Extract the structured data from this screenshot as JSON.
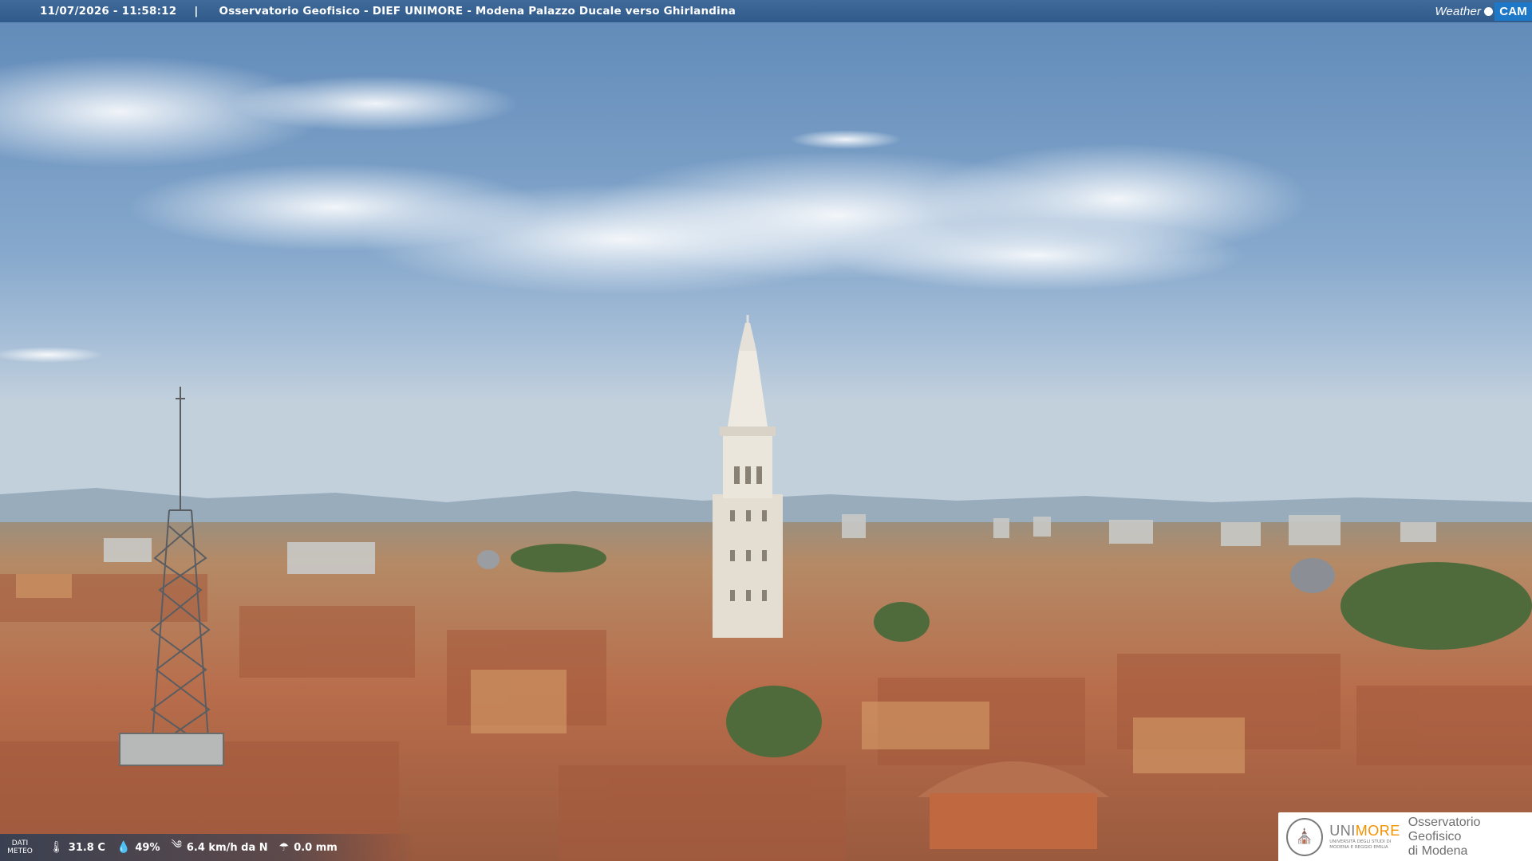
{
  "header": {
    "timestamp": "11/07/2026 - 11:58:12",
    "separator": "|",
    "title": "Osservatorio Geofisico - DIEF UNIMORE - Modena Palazzo Ducale verso Ghirlandina"
  },
  "brand": {
    "weather": "Weather",
    "cam": "CAM"
  },
  "weather_data": {
    "label_line1": "DATI",
    "label_line2": "METEO",
    "temperature": "31.8 C",
    "humidity": "49%",
    "wind": "6.4 km/h da N",
    "rain": "0.0 mm",
    "icons": [
      "thermometer-icon",
      "humidity-drop-icon",
      "wind-icon",
      "rain-icon"
    ]
  },
  "logo": {
    "uni_prefix": "UNI",
    "uni_suffix": "MORE",
    "uni_small_line1": "UNIVERSITÀ DEGLI STUDI DI",
    "uni_small_line2": "MODENA E REGGIO EMILIA",
    "obs_line1": "Osservatorio Geofisico",
    "obs_line2": "di Modena"
  },
  "colors": {
    "sky": "#7aa0c8",
    "roofs": "#b8765a",
    "tower": "#e8e4dc",
    "accent": "#f39200",
    "header": "#345f8e"
  }
}
